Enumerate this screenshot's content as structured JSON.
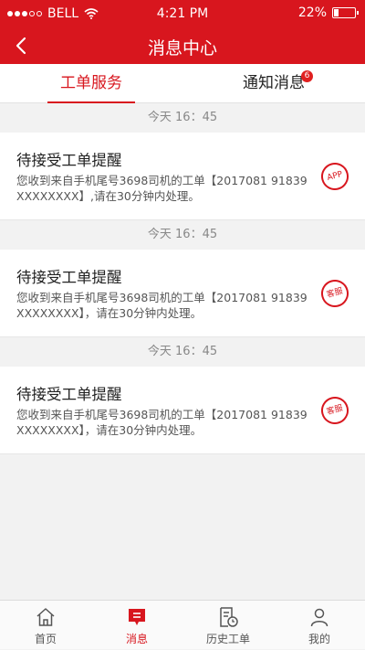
{
  "status_bar": {
    "carrier": "BELL",
    "time": "4:21 PM",
    "battery": "22%",
    "battery_level": 0.22
  },
  "nav": {
    "title": "消息中心"
  },
  "tabs": {
    "tab1": "工单服务",
    "tab2": "通知消息",
    "tab2_badge": "6"
  },
  "messages": [
    {
      "time": "今天  16：45",
      "title": "待接受工单提醒",
      "body": "您收到来自手机尾号3698司机的工单【2017081 91839XXXXXXXX】,请在30分钟内处理。",
      "stamp": "APP"
    },
    {
      "time": "今天  16：45",
      "title": "待接受工单提醒",
      "body": "您收到来自手机尾号3698司机的工单【2017081 91839XXXXXXXX】，请在30分钟内处理。",
      "stamp": "客服"
    },
    {
      "time": "今天  16：45",
      "title": "待接受工单提醒",
      "body": "您收到来自手机尾号3698司机的工单【2017081 91839XXXXXXXX】，请在30分钟内处理。",
      "stamp": "客服"
    }
  ],
  "tabbar": {
    "home": "首页",
    "messages": "消息",
    "history": "历史工单",
    "mine": "我的"
  },
  "colors": {
    "brand_red": "#d8161e"
  }
}
